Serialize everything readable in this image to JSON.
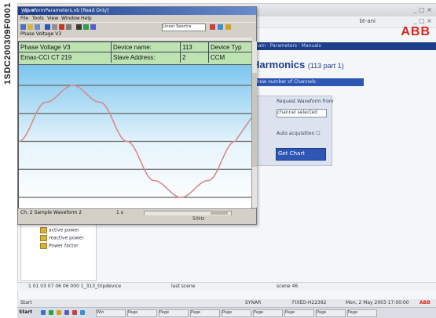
{
  "figure_code": "1SDC200309F0001",
  "background_app": {
    "title": "",
    "user_label": "bt-ani",
    "logo": "ABB",
    "nav_path": "main · Parameters · Manuals",
    "heading": "Harmonics",
    "heading_sub": "(113 part 1)",
    "section_bar": "Show number of Channels",
    "panel_label": "Request Waveform from",
    "panel_select": "channel selected",
    "panel_check": "Auto acquisition",
    "panel_button": "Get Chart",
    "tree_items": [
      "active power",
      "reactive power",
      "Power factor"
    ],
    "status_line": {
      "left": "1 01 03 07 06 06 000 1_313_tripdevice",
      "mid": "last scene",
      "right": "scene 46"
    },
    "taskbar_info": {
      "left": "Start",
      "c1": "SYNAR",
      "c2": "FIXED-H22392",
      "c3": "Mon, 2 May 2003 17:00:00",
      "logo": "ABB"
    },
    "taskbar_items": [
      "Win",
      "Page",
      "Page",
      "Page",
      "Page",
      "Page",
      "Page",
      "Page",
      "Page"
    ]
  },
  "foreground_window": {
    "title": "WaveformParameters.vb [Read Only]",
    "window_buttons": "_ □ ×",
    "menu": [
      "File",
      "Tools",
      "View",
      "Window",
      "Help"
    ],
    "toolbar_select": "Linear Spectra",
    "path_label": "Phase Voltage V3",
    "info_table": {
      "row1": [
        "Phase Voltage V3",
        "Device name:",
        "113",
        "Device Typ"
      ],
      "row2": [
        "Emax-CCI  CT 219",
        "Slave Address:",
        "2",
        "CCM"
      ]
    },
    "status_left": "Ch. 2  Sample Waveform   2",
    "status_mid": "1 s",
    "bottom_text": "50Hz"
  },
  "chart_data": {
    "type": "line",
    "title": "",
    "xlabel": "",
    "ylabel": "",
    "grid": true,
    "series": [
      {
        "x": [
          0,
          0.25,
          0.5,
          0.75,
          1,
          1.25,
          1.5,
          1.75,
          2
        ],
        "values": [
          0,
          0.7,
          1,
          0.7,
          0,
          -0.7,
          -1,
          -0.7,
          0
        ]
      }
    ],
    "xlim": [
      0,
      2.15
    ],
    "ylim": [
      -1,
      1
    ],
    "colors": {
      "line": "#d98a8a",
      "grid": "#666666",
      "fill_top": "#7cc6ef",
      "fill_bottom": "#ffffff"
    }
  }
}
